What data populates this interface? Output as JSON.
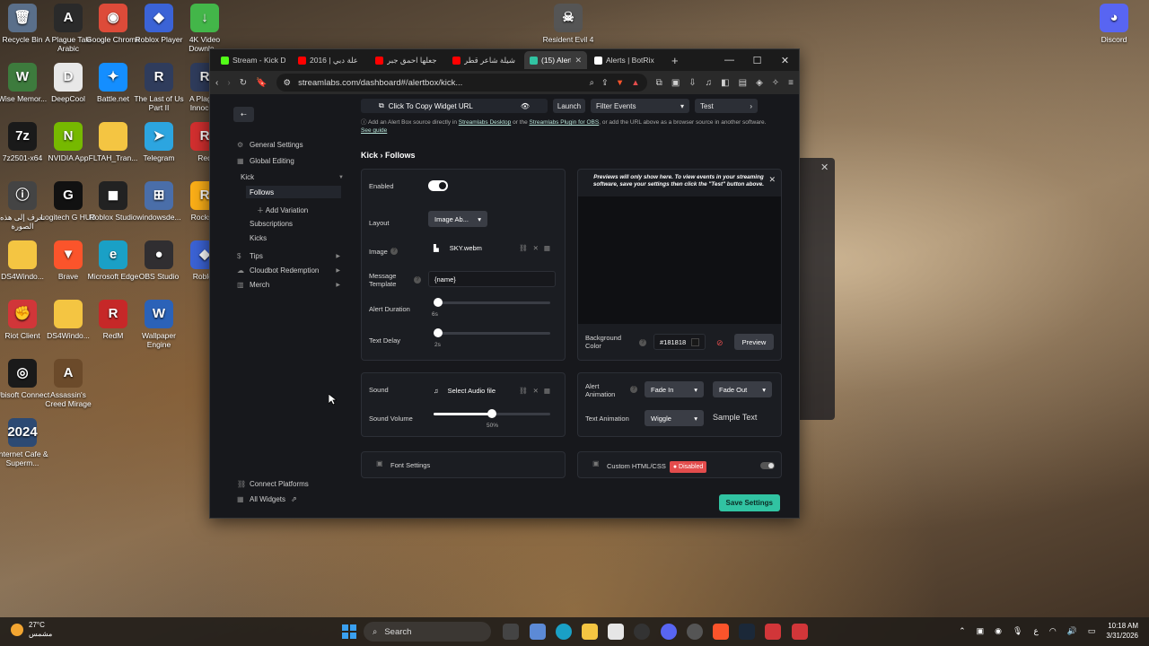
{
  "desktop": {
    "icons": [
      {
        "label": "Recycle Bin",
        "icon": "recycle-bin-icon",
        "color": "#5a6f8a",
        "glyph": "🗑"
      },
      {
        "label": "A Plague Tale Arabic",
        "icon": "game-icon",
        "color": "#2a2a2a",
        "glyph": "A"
      },
      {
        "label": "Google Chrome",
        "icon": "chrome-icon",
        "color": "#dd4b39",
        "glyph": "◉"
      },
      {
        "label": "Roblox Player",
        "icon": "roblox-icon",
        "color": "#3b63d6",
        "glyph": "◆"
      },
      {
        "label": "4K Video Downlo...",
        "icon": "download-icon",
        "color": "#43b649",
        "glyph": "↓"
      },
      {
        "label": "Wise Memor...",
        "icon": "wise-memory-icon",
        "color": "#3d7b3d",
        "glyph": "W"
      },
      {
        "label": "DeepCool",
        "icon": "deepcool-icon",
        "color": "#e8e8e8",
        "glyph": "D"
      },
      {
        "label": "Battle.net",
        "icon": "battlenet-icon",
        "color": "#148eff",
        "glyph": "✦"
      },
      {
        "label": "The Last of Us Part II",
        "icon": "game-icon",
        "color": "#2f3c5c",
        "glyph": "R"
      },
      {
        "label": "A Plague Innoce...",
        "icon": "game-icon",
        "color": "#2f3c5c",
        "glyph": "R"
      },
      {
        "label": "7z2501-x64",
        "icon": "7zip-icon",
        "color": "#1a1a1a",
        "glyph": "7z"
      },
      {
        "label": "NVIDIA App",
        "icon": "nvidia-icon",
        "color": "#76b900",
        "glyph": "N"
      },
      {
        "label": "FLTAH_Tran...",
        "icon": "folder-icon",
        "color": "#f4c542",
        "glyph": ""
      },
      {
        "label": "Telegram",
        "icon": "telegram-icon",
        "color": "#2ca5e0",
        "glyph": "➤"
      },
      {
        "label": "Red",
        "icon": "red-app-icon",
        "color": "#d32f2f",
        "glyph": "R"
      },
      {
        "label": "تعرف إلى هذه الصورة",
        "icon": "info-icon",
        "color": "#444",
        "glyph": "ⓘ"
      },
      {
        "label": "Logitech G HUB",
        "icon": "logitech-icon",
        "color": "#111",
        "glyph": "G"
      },
      {
        "label": "Roblox Studio",
        "icon": "roblox-studio-icon",
        "color": "#222",
        "glyph": "◼"
      },
      {
        "label": "windowsde...",
        "icon": "windows-app-icon",
        "color": "#4a6ea9",
        "glyph": "⊞"
      },
      {
        "label": "Rocksta",
        "icon": "rockstar-icon",
        "color": "#fcaf17",
        "glyph": "R"
      },
      {
        "label": "DS4Windo...",
        "icon": "folder-icon",
        "color": "#f4c542",
        "glyph": ""
      },
      {
        "label": "Brave",
        "icon": "brave-icon",
        "color": "#fb542b",
        "glyph": "▼"
      },
      {
        "label": "Microsoft Edge",
        "icon": "edge-icon",
        "color": "#1aa0c6",
        "glyph": "e"
      },
      {
        "label": "OBS Studio",
        "icon": "obs-icon",
        "color": "#302e31",
        "glyph": "●"
      },
      {
        "label": "Roblox",
        "icon": "roblox-icon",
        "color": "#3b63d6",
        "glyph": "◆"
      },
      {
        "label": "Riot Client",
        "icon": "riot-icon",
        "color": "#d13639",
        "glyph": "✊"
      },
      {
        "label": "DS4Windo...",
        "icon": "folder-icon",
        "color": "#f4c542",
        "glyph": ""
      },
      {
        "label": "RedM",
        "icon": "redm-icon",
        "color": "#c62828",
        "glyph": "R"
      },
      {
        "label": "Wallpaper Engine",
        "icon": "wallpaper-engine-icon",
        "color": "#2b62b8",
        "glyph": "W"
      },
      {
        "label": "Ubisoft Connect",
        "icon": "ubisoft-icon",
        "color": "#1a1a1a",
        "glyph": "◎"
      },
      {
        "label": "Assassin's Creed Mirage",
        "icon": "game-icon",
        "color": "#6b4a2a",
        "glyph": "A"
      },
      {
        "label": "Internet Cafe & Superm...",
        "icon": "game-icon",
        "color": "#2d4a73",
        "glyph": "2024"
      },
      {
        "label": "Resident Evil 4",
        "icon": "game-icon",
        "color": "#555",
        "glyph": "☠"
      },
      {
        "label": "Discord",
        "icon": "discord-icon",
        "color": "#5865f2",
        "glyph": "◕"
      }
    ]
  },
  "browser": {
    "tabs": [
      {
        "title": "Stream - Kick D",
        "color": "#53fc18",
        "active": false
      },
      {
        "title": "2016 | علة دبي",
        "color": "#ff0000",
        "active": false
      },
      {
        "title": "جعلها احمق جبر",
        "color": "#ff0000",
        "active": false
      },
      {
        "title": "شيلة شاعر قطر",
        "color": "#ff0000",
        "active": false
      },
      {
        "title": "(15) Alert",
        "color": "#31c3a2",
        "active": true
      },
      {
        "title": "Alerts | BotRix",
        "color": "#ffffff",
        "active": false
      }
    ],
    "new_tab": "+",
    "url": "streamlabs.com/dashboard#/alertbox/kick...",
    "win_min": "—",
    "win_max": "☐",
    "win_close": "✕"
  },
  "page": {
    "back": "Back to Dashboard",
    "nav": {
      "general": "General Settings",
      "global": "Global Editing",
      "kick": "Kick",
      "follows": "Follows",
      "add_variation": "Add Variation",
      "subscriptions": "Subscriptions",
      "kicks": "Kicks",
      "tips": "Tips",
      "cloudbot": "Cloudbot Redemption",
      "merch": "Merch",
      "connect": "Connect Platforms",
      "all_widgets": "All Widgets"
    },
    "top": {
      "copy_url": "Click To Copy Widget URL",
      "launch": "Launch",
      "filter": "Filter Events",
      "test": "Test",
      "info_pre": "Add an Alert Box source directly in",
      "info_link1": "Streamlabs Desktop",
      "info_mid": "or the",
      "info_link2": "Streamlabs Plugin for OBS",
      "info_post": ", or add the URL above as a browser source in another software.",
      "info_link3": "See guide"
    },
    "crumb": "Kick › Follows",
    "settings": {
      "enabled_label": "Enabled",
      "layout_label": "Layout",
      "layout_value": "Image Ab...",
      "image_label": "Image",
      "image_value": "SKY.webm",
      "message_label": "Message Template",
      "message_value": "{name}",
      "duration_label": "Alert Duration",
      "duration_value": "6s",
      "duration_fraction": 0.0,
      "delay_label": "Text Delay",
      "delay_value": "2s",
      "delay_fraction": 0.0
    },
    "preview": {
      "notice": "Previews will only show here. To view events in your streaming software, save your settings then click the \"Test\" button above.",
      "bg_label": "Background Color",
      "bg_value": "#181818",
      "preview_btn": "Preview"
    },
    "sound": {
      "label": "Sound",
      "value": "Select Audio file",
      "volume_label": "Sound Volume",
      "volume_value": "50%",
      "volume_fraction": 0.5
    },
    "animation": {
      "alert_label": "Alert Animation",
      "fade_in": "Fade In",
      "fade_out": "Fade Out",
      "text_label": "Text Animation",
      "text_value": "Wiggle",
      "sample": "Sample Text"
    },
    "font_settings": "Font Settings",
    "custom_html": "Custom HTML/CSS",
    "disabled": "Disabled",
    "save": "Save Settings"
  },
  "taskbar": {
    "temp": "27°C",
    "weather": "مشمس",
    "search": "Search",
    "lang": "ع",
    "time": "10:18 AM",
    "date": "3/31/2026"
  }
}
